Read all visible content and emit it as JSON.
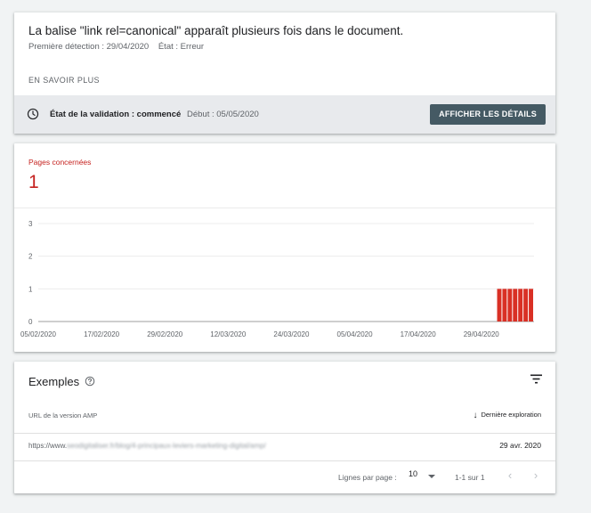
{
  "issue": {
    "title": "La balise \"link rel=canonical\" apparaît plusieurs fois dans le document.",
    "first_detection": "Première détection : 29/04/2020",
    "state": "État : Erreur",
    "learn_more": "EN SAVOIR PLUS"
  },
  "validation": {
    "state_label": "État de la validation : commencé",
    "start": "Début : 05/05/2020",
    "details_button": "AFFICHER LES DÉTAILS",
    "icon": "clock-icon"
  },
  "affected": {
    "label": "Pages concernées",
    "count": "1"
  },
  "colors": {
    "error_red": "#c5221f",
    "bar_red": "#d93025",
    "button_bg": "#455a64"
  },
  "chart_data": {
    "type": "bar",
    "xlabel": "",
    "ylabel": "",
    "ylim": [
      0,
      3
    ],
    "yticks": [
      "0",
      "1",
      "2",
      "3"
    ],
    "x_tick_labels": [
      "05/02/2020",
      "17/02/2020",
      "29/02/2020",
      "12/03/2020",
      "24/03/2020",
      "05/04/2020",
      "17/04/2020",
      "29/04/2020"
    ],
    "x_start": "05/02/2020",
    "x_end": "09/05/2020",
    "grid": true,
    "series": [
      {
        "x": [
          "02/05/2020",
          "03/05/2020",
          "04/05/2020",
          "05/05/2020",
          "06/05/2020",
          "07/05/2020",
          "08/05/2020"
        ],
        "values": [
          1,
          1,
          1,
          1,
          1,
          1,
          1
        ]
      }
    ]
  },
  "examples": {
    "title": "Exemples",
    "help_icon": "help-icon",
    "filter_icon": "filter-icon",
    "col_url": "URL de la version AMP",
    "col_date": "Dernière exploration",
    "rows": [
      {
        "url_prefix": "https://www.",
        "url_rest": "seodigitaliser.fr/blog/4-principaux-leviers-marketing-digital/amp/",
        "date": "29 avr. 2020"
      }
    ],
    "rows_per_page_label": "Lignes par page :",
    "rows_per_page": "10",
    "range": "1-1 sur 1"
  }
}
